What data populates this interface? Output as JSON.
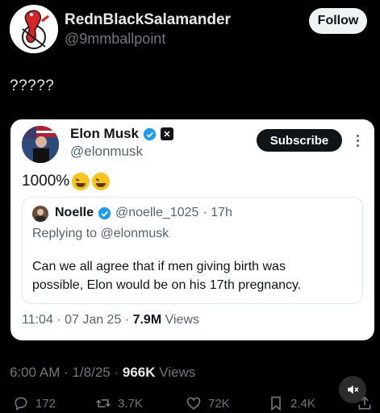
{
  "post": {
    "author_name": "RednBlackSalamander",
    "author_handle": "@9mmballpoint",
    "follow_label": "Follow",
    "text": "?????",
    "timestamp": "6:00 AM · 1/8/25 · ",
    "views_count": "966K",
    "views_label": " Views"
  },
  "quoted": {
    "name": "Elon Musk",
    "handle": "@elonmusk",
    "subscribe_label": "Subscribe",
    "text": "1000%",
    "footer_time": "11:04 · 07 Jan 25 · ",
    "footer_views_count": "7.9M",
    "footer_views_label": " Views",
    "inner": {
      "name": "Noelle",
      "handle": "@noelle_1025",
      "age": "· 17h",
      "replying_to": "Replying to @elonmusk",
      "body": "Can we all agree that if men giving birth was possible, Elon would be on his 17th pregnancy."
    }
  },
  "actions": {
    "replies": "172",
    "reposts": "3.7K",
    "likes": "72K",
    "bookmarks": "2.4K"
  },
  "colors": {
    "background": "#000000",
    "card": "#ffffff",
    "verified": "#1d9bf0",
    "muted_text": "#71767b"
  },
  "icons": [
    "reply-icon",
    "repost-icon",
    "like-icon",
    "bookmark-icon",
    "share-icon",
    "verified-icon",
    "x-logo-icon",
    "mute-icon",
    "more-icon"
  ]
}
